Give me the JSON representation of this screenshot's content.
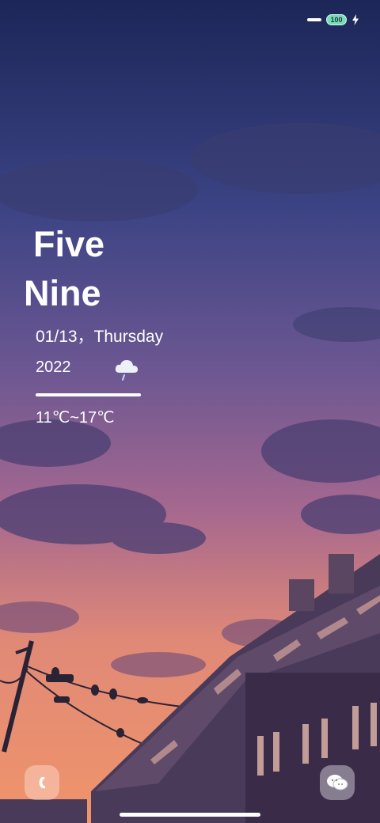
{
  "status_bar": {
    "battery_level": "100"
  },
  "clock": {
    "line1": "Five",
    "line2": "Nine"
  },
  "date": {
    "day_text": "01/13，Thursday",
    "year": "2022"
  },
  "weather": {
    "icon": "cloud-rain-icon",
    "temperature_range": "11℃~17℃"
  },
  "dock": {
    "left_icon": "phone-icon",
    "right_icon": "chat-icon"
  },
  "colors": {
    "sky_top": "#1f2c5c",
    "sky_mid": "#6a4f86",
    "sky_bottom": "#e88a6a",
    "battery": "#7bdcb4"
  }
}
